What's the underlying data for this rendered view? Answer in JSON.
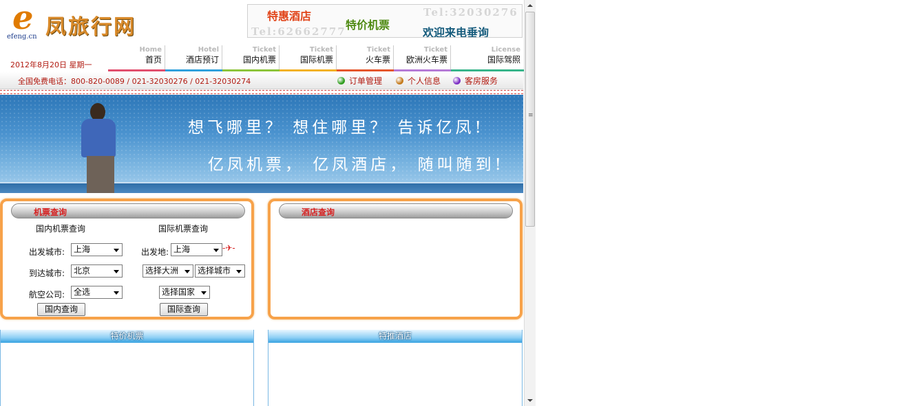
{
  "logo": {
    "letter": "e",
    "name": "凤旅行网",
    "domain": "efeng.cn"
  },
  "ad": {
    "hotel": "特惠酒店",
    "ticket": "特价机票",
    "tel1": "Tel:32030276",
    "tel2": "Tel:62662777",
    "welcome": "欢迎来电垂询"
  },
  "date": "2012年8月20日 星期一",
  "nav": [
    {
      "en": "Home",
      "cn": "首页",
      "color": "#e14e6d"
    },
    {
      "en": "Hotel",
      "cn": "酒店预订",
      "color": "#2fa0dc"
    },
    {
      "en": "Ticket",
      "cn": "国内机票",
      "color": "#8cc43a"
    },
    {
      "en": "Ticket",
      "cn": "国际机票",
      "color": "#f2b126"
    },
    {
      "en": "Ticket",
      "cn": "火车票",
      "color": "#e5562b"
    },
    {
      "en": "Ticket",
      "cn": "欧洲火车票",
      "color": "#b57ad6"
    },
    {
      "en": "License",
      "cn": "国际驾照",
      "color": "#36b58a"
    }
  ],
  "hotline": "全国免费电话：800-820-0089 / 021-32030276 / 021-32030274",
  "links": [
    {
      "label": "订单管理",
      "color": "#2e9d1e"
    },
    {
      "label": "个人信息",
      "color": "#c47a1c"
    },
    {
      "label": "客房服务",
      "color": "#7b2dc4"
    }
  ],
  "banner": {
    "line1": "想飞哪里？ 想住哪里？ 告诉亿凤!",
    "line2": "亿凤机票， 亿凤酒店， 随叫随到!"
  },
  "flight_search": {
    "title": "机票查询",
    "domestic": {
      "heading": "国内机票查询",
      "depart_label": "出发城市:",
      "depart_value": "上海",
      "arrive_label": "到达城市:",
      "arrive_value": "北京",
      "airline_label": "航空公司:",
      "airline_value": "全选",
      "button": "国内查询"
    },
    "international": {
      "heading": "国际机票查询",
      "depart_label": "出发地:",
      "depart_value": "上海",
      "continent_value": "选择大洲",
      "city_value": "选择城市",
      "country_value": "选择国家",
      "button": "国际查询"
    }
  },
  "hotel_search": {
    "title": "酒店查询"
  },
  "sections": {
    "flights": "特价机票",
    "hotels": "特推酒店"
  }
}
